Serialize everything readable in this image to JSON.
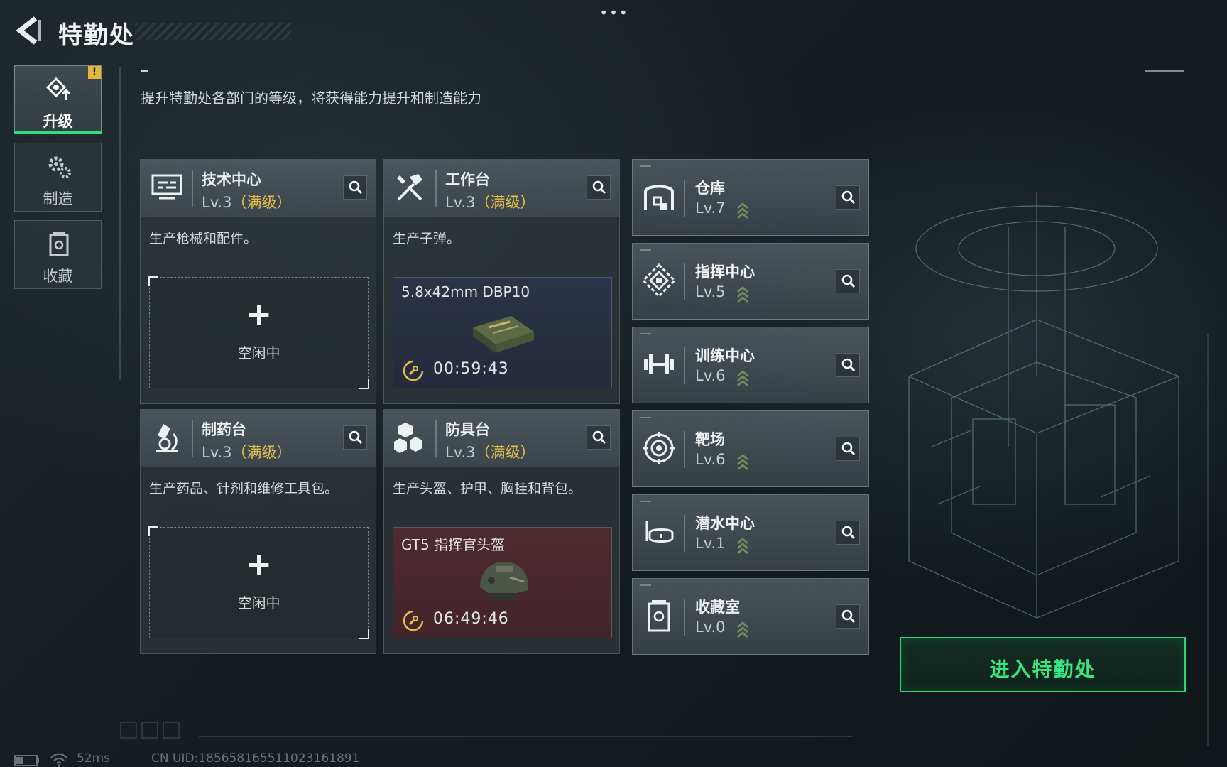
{
  "header": {
    "title": "特勤处",
    "more_label": "•••"
  },
  "side_tabs": [
    {
      "label": "升级",
      "icon": "upgrade-icon",
      "active": true,
      "alert": "!"
    },
    {
      "label": "制造",
      "icon": "craft-gears-icon",
      "active": false
    },
    {
      "label": "收藏",
      "icon": "collection-icon",
      "active": false
    }
  ],
  "subtitle": "提升特勤处各部门的等级，将获得能力提升和制造能力",
  "workshops": [
    {
      "name": "技术中心",
      "level": "Lv.3",
      "maxed": "（满级）",
      "icon": "tech-center-icon",
      "description": "生产枪械和配件。",
      "slot": {
        "state": "idle",
        "plus": "+",
        "label": "空闲中"
      }
    },
    {
      "name": "工作台",
      "level": "Lv.3",
      "maxed": "（满级）",
      "icon": "workbench-hammer-icon",
      "description": "生产子弹。",
      "slot": {
        "state": "busy",
        "item": "5.8x42mm DBP10",
        "timer": "00:59:43",
        "item_icon": "ammo-box-icon"
      }
    },
    {
      "name": "制药台",
      "level": "Lv.3",
      "maxed": "（满级）",
      "icon": "pharmacy-microscope-icon",
      "description": "生产药品、针剂和维修工具包。",
      "slot": {
        "state": "idle",
        "plus": "+",
        "label": "空闲中"
      }
    },
    {
      "name": "防具台",
      "level": "Lv.3",
      "maxed": "（满级）",
      "icon": "armor-bench-icon",
      "description": "生产头盔、护甲、胸挂和背包。",
      "slot": {
        "state": "busy",
        "item": "GT5 指挥官头盔",
        "timer": "06:49:46",
        "item_icon": "helmet-icon"
      }
    }
  ],
  "facilities": [
    {
      "name": "仓库",
      "level": "Lv.7",
      "icon": "warehouse-icon"
    },
    {
      "name": "指挥中心",
      "level": "Lv.5",
      "icon": "command-center-icon"
    },
    {
      "name": "训练中心",
      "level": "Lv.6",
      "icon": "training-dumbbell-icon"
    },
    {
      "name": "靶场",
      "level": "Lv.6",
      "icon": "target-range-icon"
    },
    {
      "name": "潜水中心",
      "level": "Lv.1",
      "icon": "diving-mask-icon"
    },
    {
      "name": "收藏室",
      "level": "Lv.0",
      "icon": "collection-room-icon"
    }
  ],
  "enter_button": {
    "label": "进入特勤处"
  },
  "status": {
    "ping": "52ms",
    "uid": "CN UID:1856581655110231618​91"
  },
  "colors": {
    "accent_green": "#2ee07a",
    "maxed_gold": "#e6c04a",
    "alert_yellow": "#e3b53a",
    "ammo_slot": "#2c3346",
    "armor_slot": "#4d2a30"
  }
}
